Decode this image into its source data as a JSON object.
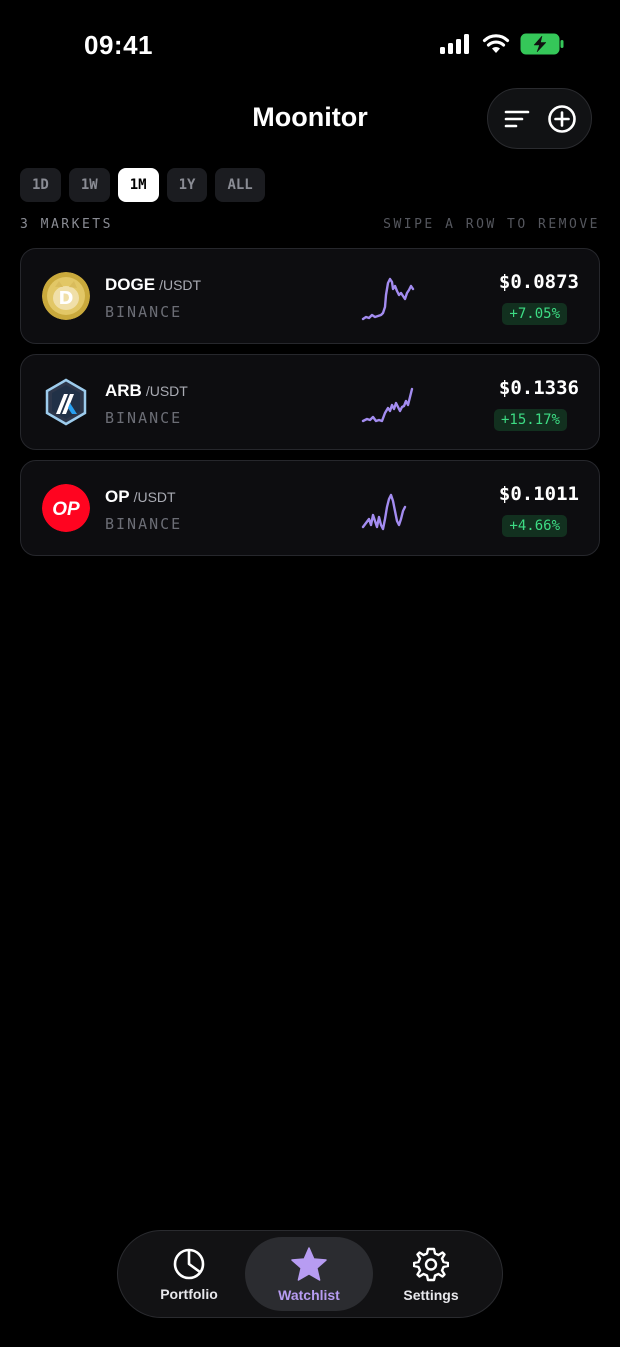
{
  "status_bar": {
    "time": "09:41"
  },
  "header": {
    "title": "Moonitor"
  },
  "range_tabs": [
    {
      "label": "1D",
      "active": false
    },
    {
      "label": "1W",
      "active": false
    },
    {
      "label": "1M",
      "active": true
    },
    {
      "label": "1Y",
      "active": false
    },
    {
      "label": "ALL",
      "active": false
    }
  ],
  "meta": {
    "count": "3 MARKETS",
    "hint": "SWIPE A ROW TO REMOVE"
  },
  "markets": [
    {
      "base": "DOGE",
      "quote": "/USDT",
      "exchange": "BINANCE",
      "price": "$0.0873",
      "change": "+7.05%",
      "logo": "doge-logo"
    },
    {
      "base": "ARB",
      "quote": "/USDT",
      "exchange": "BINANCE",
      "price": "$0.1336",
      "change": "+15.17%",
      "logo": "arb-logo"
    },
    {
      "base": "OP",
      "quote": "/USDT",
      "exchange": "BINANCE",
      "price": "$0.1011",
      "change": "+4.66%",
      "logo": "op-logo",
      "logo_text": "OP"
    }
  ],
  "tab_bar": [
    {
      "label": "Portfolio",
      "icon": "pie-chart-icon",
      "active": false
    },
    {
      "label": "Watchlist",
      "icon": "star-icon",
      "active": true
    },
    {
      "label": "Settings",
      "icon": "gear-icon",
      "active": false
    }
  ],
  "colors": {
    "accent": "#b79cf2",
    "sparkline": "#a38cf0",
    "positive": "#3ddc84",
    "background": "#000000"
  }
}
